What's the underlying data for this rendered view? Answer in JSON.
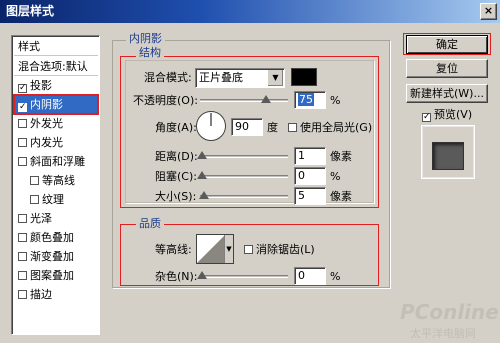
{
  "window": {
    "title": "图层样式",
    "close_glyph": "×"
  },
  "sidebar": {
    "header": "样式",
    "items": [
      {
        "label": "混合选项:默认",
        "checkbox": false
      },
      {
        "label": "投影",
        "checkbox": true,
        "checked": true
      },
      {
        "label": "内阴影",
        "checkbox": true,
        "checked": true,
        "selected": true
      },
      {
        "label": "外发光",
        "checkbox": true,
        "checked": false
      },
      {
        "label": "内发光",
        "checkbox": true,
        "checked": false
      },
      {
        "label": "斜面和浮雕",
        "checkbox": true,
        "checked": false
      },
      {
        "label": "等高线",
        "checkbox": true,
        "checked": false,
        "indent": true
      },
      {
        "label": "纹理",
        "checkbox": true,
        "checked": false,
        "indent": true
      },
      {
        "label": "光泽",
        "checkbox": true,
        "checked": false
      },
      {
        "label": "颜色叠加",
        "checkbox": true,
        "checked": false
      },
      {
        "label": "渐变叠加",
        "checkbox": true,
        "checked": false
      },
      {
        "label": "图案叠加",
        "checkbox": true,
        "checked": false
      },
      {
        "label": "描边",
        "checkbox": true,
        "checked": false
      }
    ]
  },
  "panel": {
    "title": "内阴影",
    "structure": {
      "title": "结构",
      "blend_mode_label": "混合模式:",
      "blend_mode_value": "正片叠底",
      "shadow_color": "#000000",
      "opacity_label": "不透明度(O):",
      "opacity_value": "75",
      "opacity_unit": "%",
      "opacity_fraction": 0.75,
      "angle_label": "角度(A):",
      "angle_value": "90",
      "angle_unit": "度",
      "global_light_label": "使用全局光(G)",
      "global_light_checked": false,
      "distance_label": "距离(D):",
      "distance_value": "1",
      "distance_unit": "像素",
      "choke_label": "阻塞(C):",
      "choke_value": "0",
      "choke_unit": "%",
      "size_label": "大小(S):",
      "size_value": "5",
      "size_unit": "像素"
    },
    "quality": {
      "title": "品质",
      "contour_label": "等高线:",
      "anti_alias_label": "消除锯齿(L)",
      "anti_alias_checked": false,
      "noise_label": "杂色(N):",
      "noise_value": "0",
      "noise_unit": "%"
    }
  },
  "buttons": {
    "ok": "确定",
    "reset": "复位",
    "new_style": "新建样式(W)...",
    "preview_label": "预览(V)",
    "preview_checked": true
  },
  "watermark": {
    "brand": "PConline",
    "tagline": "太平洋电脑网"
  },
  "colors": {
    "highlight_red": "#e02020",
    "selection_blue": "#316ac5",
    "title_blue": "#0a246a"
  }
}
